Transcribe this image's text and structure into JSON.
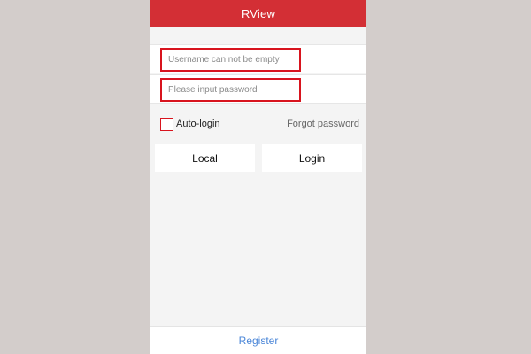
{
  "app": {
    "title": "RView"
  },
  "login_form": {
    "username": {
      "value": "",
      "placeholder": "Username can not be empty"
    },
    "password": {
      "value": "",
      "placeholder": "Please input password"
    },
    "auto_login": {
      "label": "Auto-login",
      "checked": false
    },
    "forgot_password_label": "Forgot password",
    "local_button_label": "Local",
    "login_button_label": "Login"
  },
  "footer": {
    "register_label": "Register"
  },
  "colors": {
    "header_bg": "#d32f35",
    "error_border": "#d8141e",
    "link_blue": "#4a86d8",
    "page_bg": "#f4f4f4"
  }
}
